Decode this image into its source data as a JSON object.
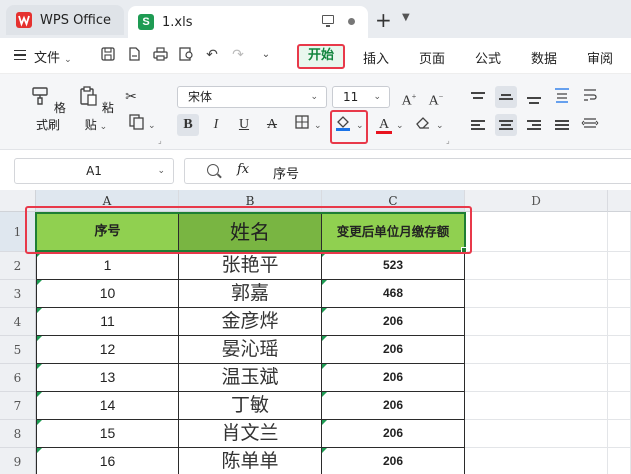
{
  "titlebar": {
    "home_tab": "WPS Office",
    "file_tab": "1.xls",
    "file_icon_letter": "S"
  },
  "menubar": {
    "file_label": "文件",
    "tabs": [
      "开始",
      "插入",
      "页面",
      "公式",
      "数据",
      "审阅"
    ],
    "active_tab": "开始"
  },
  "ribbon": {
    "format_painter": "格式刷",
    "paste": "粘贴",
    "font_name": "宋体",
    "font_size": "11",
    "bold": "B",
    "italic": "I",
    "underline": "U",
    "strike": "A",
    "grow_font": "A",
    "shrink_font": "A",
    "font_color_glyph": "A",
    "fill_color": "#1a73e8",
    "font_color": "#e8131f"
  },
  "formula_bar": {
    "cell_ref": "A1",
    "fx": "fx",
    "value": "序号"
  },
  "sheet": {
    "columns": [
      "A",
      "B",
      "C",
      "D"
    ],
    "rows": [
      "1",
      "2",
      "3",
      "4",
      "5",
      "6",
      "7",
      "8",
      "9"
    ],
    "header": [
      "序号",
      "姓名",
      "变更后单位月缴存额"
    ],
    "data": [
      [
        "1",
        "张艳平",
        "523"
      ],
      [
        "10",
        "郭嘉",
        "468"
      ],
      [
        "11",
        "金彦烨",
        "206"
      ],
      [
        "12",
        "晏沁瑶",
        "206"
      ],
      [
        "13",
        "温玉斌",
        "206"
      ],
      [
        "14",
        "丁敏",
        "206"
      ],
      [
        "15",
        "肖文兰",
        "206"
      ],
      [
        "16",
        "陈单单",
        "206"
      ]
    ]
  }
}
